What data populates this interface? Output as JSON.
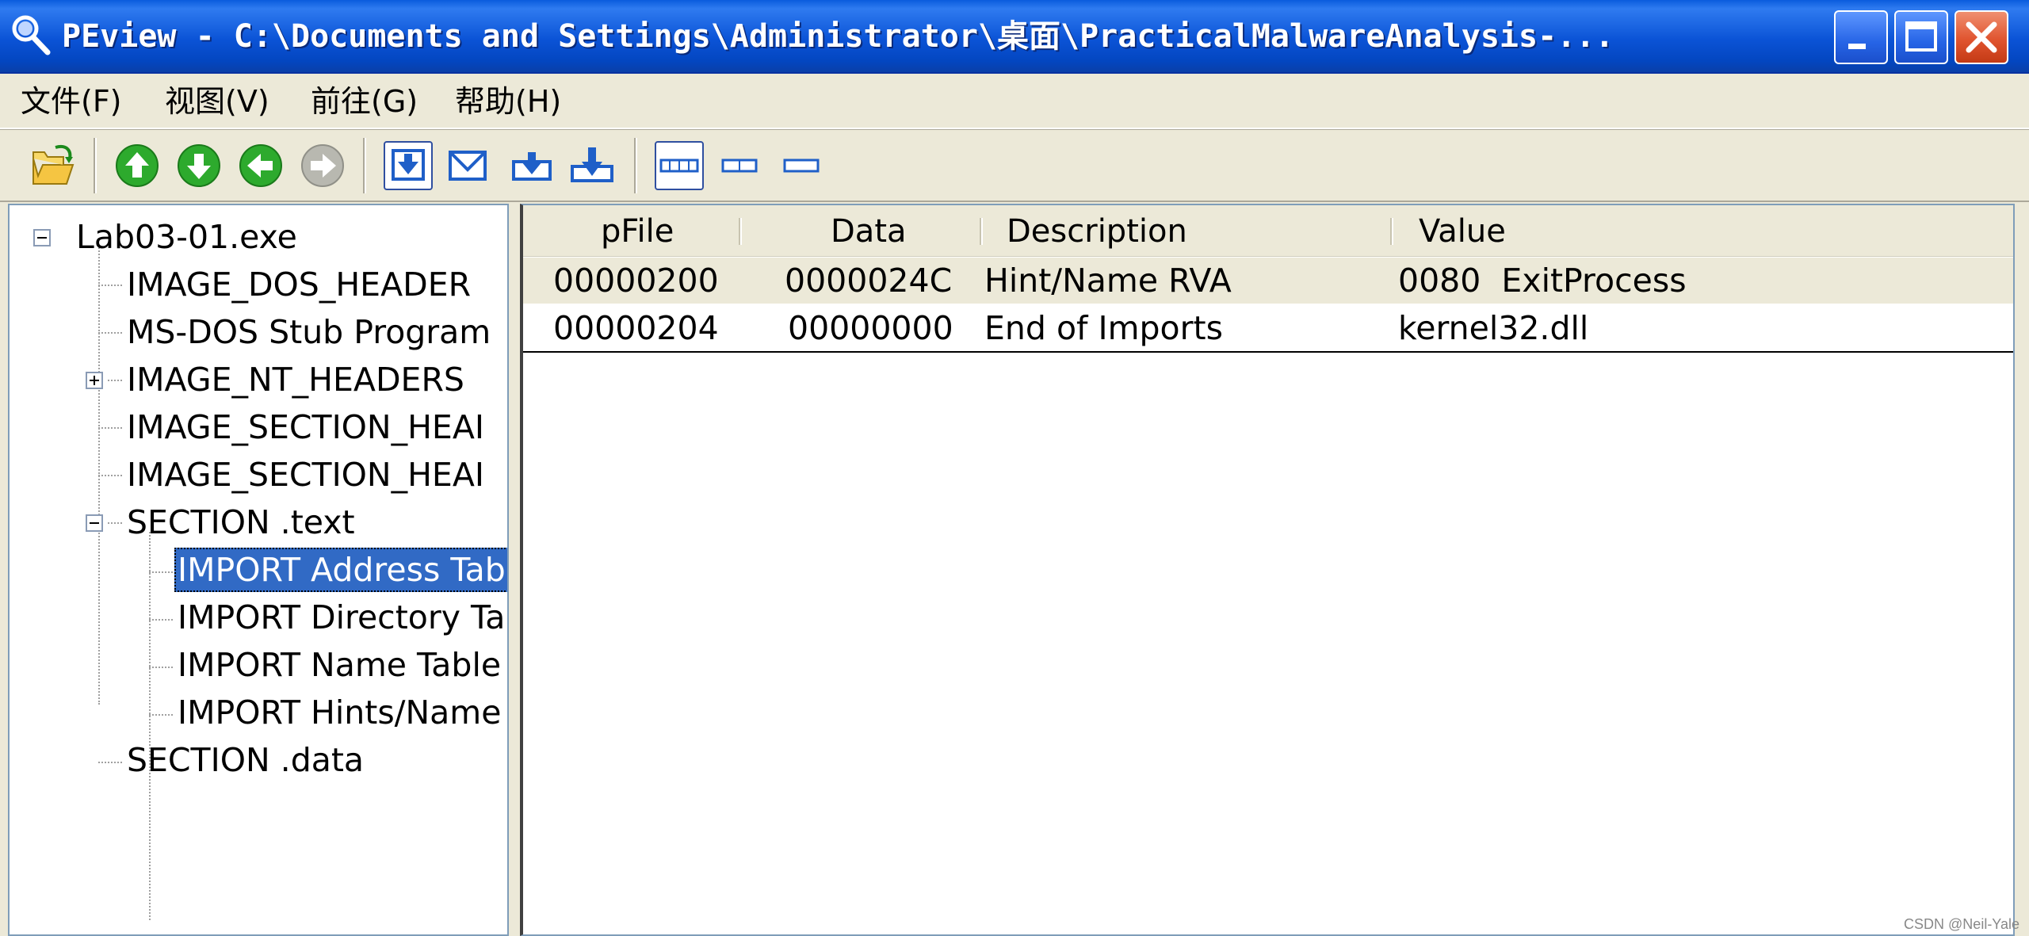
{
  "window": {
    "title": "PEview - C:\\Documents and Settings\\Administrator\\桌面\\PracticalMalwareAnalysis-..."
  },
  "menu": [
    {
      "label": "文件(F)"
    },
    {
      "label": "视图(V)"
    },
    {
      "label": "前往(G)"
    },
    {
      "label": "帮助(H)"
    }
  ],
  "toolbar": {
    "icons": [
      "open-icon",
      "up-arrow-icon",
      "down-arrow-icon",
      "back-arrow-icon",
      "forward-arrow-icon",
      "view-byte-icon",
      "view-word-icon",
      "view-dword-icon",
      "view-qword-icon",
      "view-wide-icon",
      "view-medium-icon",
      "view-narrow-icon"
    ]
  },
  "tree": {
    "items": [
      {
        "label": "Lab03-01.exe",
        "expander": "minus"
      },
      {
        "label": "IMAGE_DOS_HEADER"
      },
      {
        "label": "MS-DOS Stub Program"
      },
      {
        "label": "IMAGE_NT_HEADERS",
        "expander": "plus"
      },
      {
        "label": "IMAGE_SECTION_HEAI"
      },
      {
        "label": "IMAGE_SECTION_HEAI"
      },
      {
        "label": "SECTION .text",
        "expander": "minus"
      },
      {
        "label": "IMPORT Address Tab",
        "selected": true
      },
      {
        "label": "IMPORT Directory Ta"
      },
      {
        "label": "IMPORT Name Table"
      },
      {
        "label": "IMPORT Hints/Name"
      },
      {
        "label": "SECTION .data"
      }
    ]
  },
  "table": {
    "columns": [
      "pFile",
      "Data",
      "Description",
      "Value"
    ],
    "rows": [
      {
        "pfile": "00000200",
        "data": "0000024C",
        "description": "Hint/Name RVA",
        "value": "0080  ExitProcess"
      },
      {
        "pfile": "00000204",
        "data": "00000000",
        "description": "End of Imports",
        "value": "kernel32.dll"
      }
    ]
  },
  "watermark": "CSDN @Neil-Yale",
  "colors": {
    "titlebar": "#0B53D6",
    "selection": "#316AC5",
    "chrome": "#ECE9D8"
  }
}
